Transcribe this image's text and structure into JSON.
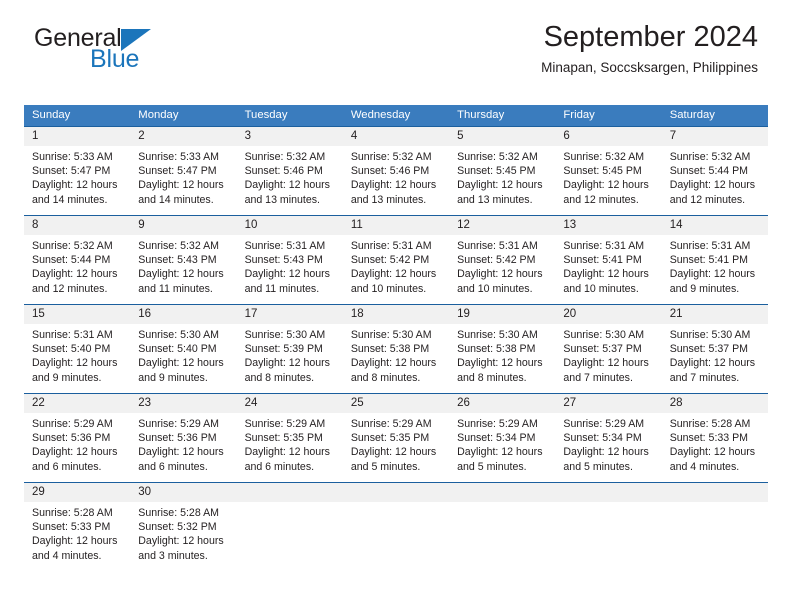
{
  "brand": {
    "line1": "General",
    "line2": "Blue",
    "triangle_color": "#1b75bb"
  },
  "header": {
    "title": "September 2024",
    "subtitle": "Minapan, Soccsksargen, Philippines"
  },
  "colors": {
    "header_blue": "#3a7cbe",
    "week_divider": "#1b5f9e",
    "daynum_band": "#f1f1f1",
    "text": "#231f20"
  },
  "weekdays": [
    "Sunday",
    "Monday",
    "Tuesday",
    "Wednesday",
    "Thursday",
    "Friday",
    "Saturday"
  ],
  "weeks": [
    [
      {
        "day": "1",
        "sunrise": "Sunrise: 5:33 AM",
        "sunset": "Sunset: 5:47 PM",
        "daylight1": "Daylight: 12 hours",
        "daylight2": "and 14 minutes."
      },
      {
        "day": "2",
        "sunrise": "Sunrise: 5:33 AM",
        "sunset": "Sunset: 5:47 PM",
        "daylight1": "Daylight: 12 hours",
        "daylight2": "and 14 minutes."
      },
      {
        "day": "3",
        "sunrise": "Sunrise: 5:32 AM",
        "sunset": "Sunset: 5:46 PM",
        "daylight1": "Daylight: 12 hours",
        "daylight2": "and 13 minutes."
      },
      {
        "day": "4",
        "sunrise": "Sunrise: 5:32 AM",
        "sunset": "Sunset: 5:46 PM",
        "daylight1": "Daylight: 12 hours",
        "daylight2": "and 13 minutes."
      },
      {
        "day": "5",
        "sunrise": "Sunrise: 5:32 AM",
        "sunset": "Sunset: 5:45 PM",
        "daylight1": "Daylight: 12 hours",
        "daylight2": "and 13 minutes."
      },
      {
        "day": "6",
        "sunrise": "Sunrise: 5:32 AM",
        "sunset": "Sunset: 5:45 PM",
        "daylight1": "Daylight: 12 hours",
        "daylight2": "and 12 minutes."
      },
      {
        "day": "7",
        "sunrise": "Sunrise: 5:32 AM",
        "sunset": "Sunset: 5:44 PM",
        "daylight1": "Daylight: 12 hours",
        "daylight2": "and 12 minutes."
      }
    ],
    [
      {
        "day": "8",
        "sunrise": "Sunrise: 5:32 AM",
        "sunset": "Sunset: 5:44 PM",
        "daylight1": "Daylight: 12 hours",
        "daylight2": "and 12 minutes."
      },
      {
        "day": "9",
        "sunrise": "Sunrise: 5:32 AM",
        "sunset": "Sunset: 5:43 PM",
        "daylight1": "Daylight: 12 hours",
        "daylight2": "and 11 minutes."
      },
      {
        "day": "10",
        "sunrise": "Sunrise: 5:31 AM",
        "sunset": "Sunset: 5:43 PM",
        "daylight1": "Daylight: 12 hours",
        "daylight2": "and 11 minutes."
      },
      {
        "day": "11",
        "sunrise": "Sunrise: 5:31 AM",
        "sunset": "Sunset: 5:42 PM",
        "daylight1": "Daylight: 12 hours",
        "daylight2": "and 10 minutes."
      },
      {
        "day": "12",
        "sunrise": "Sunrise: 5:31 AM",
        "sunset": "Sunset: 5:42 PM",
        "daylight1": "Daylight: 12 hours",
        "daylight2": "and 10 minutes."
      },
      {
        "day": "13",
        "sunrise": "Sunrise: 5:31 AM",
        "sunset": "Sunset: 5:41 PM",
        "daylight1": "Daylight: 12 hours",
        "daylight2": "and 10 minutes."
      },
      {
        "day": "14",
        "sunrise": "Sunrise: 5:31 AM",
        "sunset": "Sunset: 5:41 PM",
        "daylight1": "Daylight: 12 hours",
        "daylight2": "and 9 minutes."
      }
    ],
    [
      {
        "day": "15",
        "sunrise": "Sunrise: 5:31 AM",
        "sunset": "Sunset: 5:40 PM",
        "daylight1": "Daylight: 12 hours",
        "daylight2": "and 9 minutes."
      },
      {
        "day": "16",
        "sunrise": "Sunrise: 5:30 AM",
        "sunset": "Sunset: 5:40 PM",
        "daylight1": "Daylight: 12 hours",
        "daylight2": "and 9 minutes."
      },
      {
        "day": "17",
        "sunrise": "Sunrise: 5:30 AM",
        "sunset": "Sunset: 5:39 PM",
        "daylight1": "Daylight: 12 hours",
        "daylight2": "and 8 minutes."
      },
      {
        "day": "18",
        "sunrise": "Sunrise: 5:30 AM",
        "sunset": "Sunset: 5:38 PM",
        "daylight1": "Daylight: 12 hours",
        "daylight2": "and 8 minutes."
      },
      {
        "day": "19",
        "sunrise": "Sunrise: 5:30 AM",
        "sunset": "Sunset: 5:38 PM",
        "daylight1": "Daylight: 12 hours",
        "daylight2": "and 8 minutes."
      },
      {
        "day": "20",
        "sunrise": "Sunrise: 5:30 AM",
        "sunset": "Sunset: 5:37 PM",
        "daylight1": "Daylight: 12 hours",
        "daylight2": "and 7 minutes."
      },
      {
        "day": "21",
        "sunrise": "Sunrise: 5:30 AM",
        "sunset": "Sunset: 5:37 PM",
        "daylight1": "Daylight: 12 hours",
        "daylight2": "and 7 minutes."
      }
    ],
    [
      {
        "day": "22",
        "sunrise": "Sunrise: 5:29 AM",
        "sunset": "Sunset: 5:36 PM",
        "daylight1": "Daylight: 12 hours",
        "daylight2": "and 6 minutes."
      },
      {
        "day": "23",
        "sunrise": "Sunrise: 5:29 AM",
        "sunset": "Sunset: 5:36 PM",
        "daylight1": "Daylight: 12 hours",
        "daylight2": "and 6 minutes."
      },
      {
        "day": "24",
        "sunrise": "Sunrise: 5:29 AM",
        "sunset": "Sunset: 5:35 PM",
        "daylight1": "Daylight: 12 hours",
        "daylight2": "and 6 minutes."
      },
      {
        "day": "25",
        "sunrise": "Sunrise: 5:29 AM",
        "sunset": "Sunset: 5:35 PM",
        "daylight1": "Daylight: 12 hours",
        "daylight2": "and 5 minutes."
      },
      {
        "day": "26",
        "sunrise": "Sunrise: 5:29 AM",
        "sunset": "Sunset: 5:34 PM",
        "daylight1": "Daylight: 12 hours",
        "daylight2": "and 5 minutes."
      },
      {
        "day": "27",
        "sunrise": "Sunrise: 5:29 AM",
        "sunset": "Sunset: 5:34 PM",
        "daylight1": "Daylight: 12 hours",
        "daylight2": "and 5 minutes."
      },
      {
        "day": "28",
        "sunrise": "Sunrise: 5:28 AM",
        "sunset": "Sunset: 5:33 PM",
        "daylight1": "Daylight: 12 hours",
        "daylight2": "and 4 minutes."
      }
    ],
    [
      {
        "day": "29",
        "sunrise": "Sunrise: 5:28 AM",
        "sunset": "Sunset: 5:33 PM",
        "daylight1": "Daylight: 12 hours",
        "daylight2": "and 4 minutes."
      },
      {
        "day": "30",
        "sunrise": "Sunrise: 5:28 AM",
        "sunset": "Sunset: 5:32 PM",
        "daylight1": "Daylight: 12 hours",
        "daylight2": "and 3 minutes."
      },
      {
        "day": "",
        "sunrise": "",
        "sunset": "",
        "daylight1": "",
        "daylight2": ""
      },
      {
        "day": "",
        "sunrise": "",
        "sunset": "",
        "daylight1": "",
        "daylight2": ""
      },
      {
        "day": "",
        "sunrise": "",
        "sunset": "",
        "daylight1": "",
        "daylight2": ""
      },
      {
        "day": "",
        "sunrise": "",
        "sunset": "",
        "daylight1": "",
        "daylight2": ""
      },
      {
        "day": "",
        "sunrise": "",
        "sunset": "",
        "daylight1": "",
        "daylight2": ""
      }
    ]
  ]
}
